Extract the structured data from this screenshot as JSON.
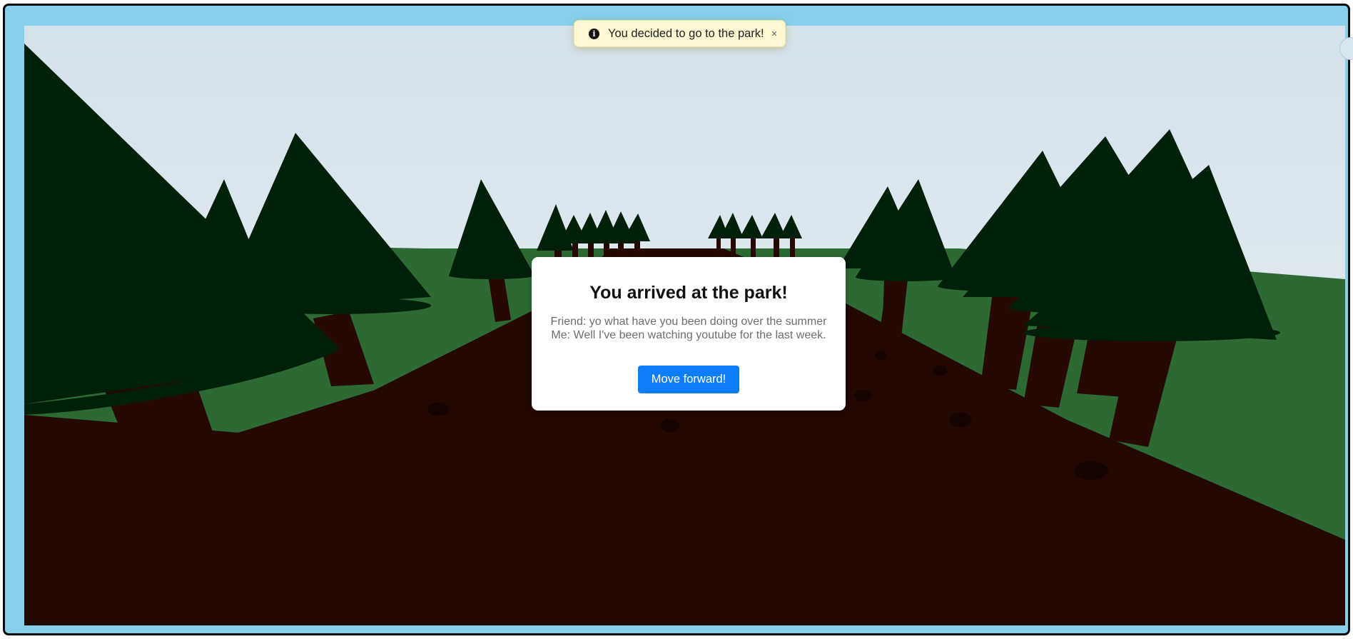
{
  "notification": {
    "icon": "info-icon",
    "message": "You decided to go to the park!",
    "close_label": "×"
  },
  "dialog": {
    "title": "You arrived at the park!",
    "lines": [
      "Friend: yo what have you been doing over the summer",
      "Me: Well I've been watching youtube for the last week."
    ],
    "button_label": "Move forward!"
  },
  "colors": {
    "sky_top": "#d4e2ec",
    "sky_bottom": "#eceff1",
    "grass": "#2d6a33",
    "path": "#240802",
    "foliage": "#01200a",
    "trunk": "#270903",
    "frame": "#87cfeb",
    "button": "#0d7ef8"
  }
}
